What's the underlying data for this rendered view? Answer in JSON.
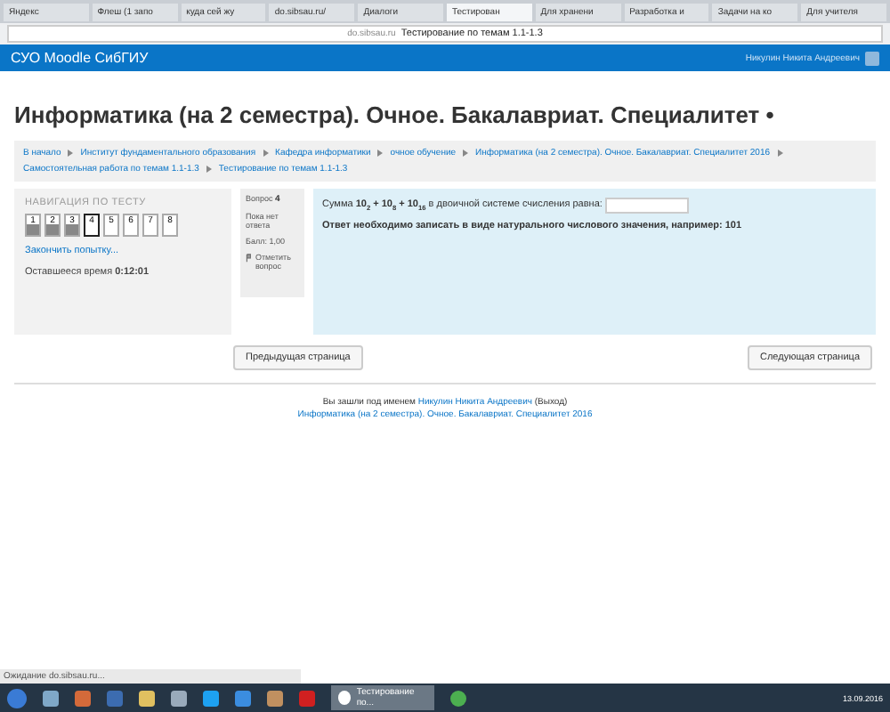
{
  "browser": {
    "tabs": [
      {
        "label": "Яндекс",
        "selected": false
      },
      {
        "label": "Флеш (1 запо",
        "selected": false
      },
      {
        "label": "куда сей жу",
        "selected": false
      },
      {
        "label": "do.sibsau.ru/",
        "selected": false
      },
      {
        "label": "Диалоги",
        "selected": false
      },
      {
        "label": "Тестирован",
        "selected": true
      },
      {
        "label": "Для хранени",
        "selected": false
      },
      {
        "label": "Разработка и",
        "selected": false
      },
      {
        "label": "Задачи на ко",
        "selected": false
      },
      {
        "label": "Для учителя",
        "selected": false
      }
    ],
    "address": {
      "domain": "do.sibsau.ru",
      "title": "Тестирование по темам 1.1-1.3"
    }
  },
  "header": {
    "brand": "СУО Moodle СибГИУ",
    "user": "Никулин Никита Андреевич"
  },
  "page_title": "Информатика (на 2 семестра). Очное. Бакалавриат. Специалитет •",
  "breadcrumb": [
    "В начало",
    "Институт фундаментального образования",
    "Кафедра информатики",
    "очное обучение",
    "Информатика (на 2 семестра). Очное. Бакалавриат. Специалитет 2016",
    "Самостоятельная работа по темам 1.1-1.3",
    "Тестирование по темам 1.1-1.3"
  ],
  "quiz_nav": {
    "title": "НАВИГАЦИЯ ПО ТЕСТУ",
    "buttons": [
      {
        "label": "1",
        "answered": true,
        "selected": false
      },
      {
        "label": "2",
        "answered": true,
        "selected": false
      },
      {
        "label": "3",
        "answered": true,
        "selected": false
      },
      {
        "label": "4",
        "answered": false,
        "selected": true
      },
      {
        "label": "5",
        "answered": false,
        "selected": false
      },
      {
        "label": "6",
        "answered": false,
        "selected": false
      },
      {
        "label": "7",
        "answered": false,
        "selected": false
      },
      {
        "label": "8",
        "answered": false,
        "selected": false
      }
    ],
    "finish_link": "Закончить попытку...",
    "time_label": "Оставшееся время",
    "time": "0:12:01"
  },
  "question_info": {
    "label": "Вопрос",
    "number": "4",
    "status": "Пока нет ответа",
    "grade": "Балл: 1,00",
    "flag": "Отметить вопрос"
  },
  "question": {
    "text": "Сумма **10$_{2}$ + 10$_{8}$ + 10$_{16}$** в двоичной системе счисления равна:",
    "hint": "Ответ необходимо записать в виде натурального числового значения, например: 101"
  },
  "buttons": {
    "previous": "Предыдущая страница",
    "next": "Следующая страница"
  },
  "footer": {
    "logged_in": "Вы зашли под именем",
    "user": "Никулин Никита Андреевич",
    "logout": "(Выход)",
    "course": "Информатика (на 2 семестра). Очное. Бакалавриат. Специалитет 2016"
  },
  "status_bar": "Ожидание do.sibsau.ru...",
  "taskbar": {
    "active_window": "Тестирование по...",
    "date": "13.09.2016"
  }
}
